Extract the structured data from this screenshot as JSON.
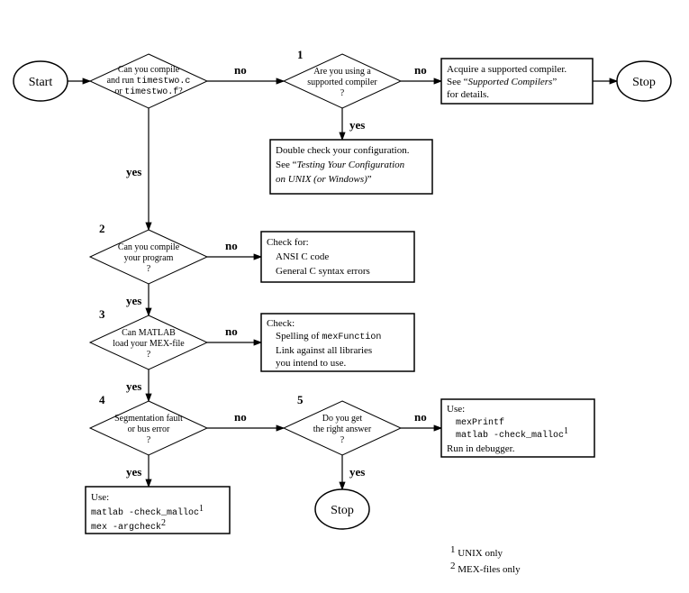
{
  "start": "Start",
  "stop": "Stop",
  "edge": {
    "yes": "yes",
    "no": "no"
  },
  "d0": {
    "l1": "Can you compile",
    "l2a": "and run ",
    "l2b": "timestwo.c",
    "l3a": "or ",
    "l3b": "timestwo.f",
    "l3c": "?"
  },
  "d1": {
    "num": "1",
    "l1": "Are you using a",
    "l2": "supported compiler",
    "l3": "?"
  },
  "p1": {
    "l1": "Acquire a supported compiler.",
    "l2a": "See “",
    "l2b": "Supported Compilers",
    "l2c": "”",
    "l3": "for details."
  },
  "p2": {
    "l1": "Double check your configuration.",
    "l2a": "See “",
    "l2b": "Testing Your Configuration",
    "l3a": "on UNIX",
    "l3b": " (or Windows)",
    "l3c": "”"
  },
  "d2": {
    "num": "2",
    "l1": "Can you compile",
    "l2": "your program",
    "l3": "?"
  },
  "p3": {
    "l1": "Check for:",
    "l2": "ANSI C code",
    "l3": "General C syntax errors"
  },
  "d3": {
    "num": "3",
    "l1": "Can MATLAB",
    "l2": "load your MEX-file",
    "l3": "?"
  },
  "p4": {
    "l1": "Check:",
    "l2a": "Spelling of ",
    "l2b": "mexFunction",
    "l3": "Link against all libraries",
    "l4": "you intend to use."
  },
  "d4": {
    "num": "4",
    "l1": "Segmentation fault",
    "l2": "or bus error",
    "l3": "?"
  },
  "p5": {
    "l1": "Use:",
    "l2": "matlab -check_malloc",
    "l2sup": "1",
    "l3": "mex -argcheck",
    "l3sup": "2"
  },
  "d5": {
    "num": "5",
    "l1": "Do you get",
    "l2": "the right answer",
    "l3": "?"
  },
  "p6": {
    "l1": "Use:",
    "l2": "mexPrintf",
    "l3": "matlab -check_malloc",
    "l3sup": "1",
    "l4": "Run in debugger."
  },
  "foot": {
    "n1sup": "1",
    "n1": " UNIX only",
    "n2sup": "2",
    "n2": " MEX-files only"
  },
  "chart_data": {
    "type": "flowchart",
    "nodes": [
      {
        "id": "start",
        "type": "terminal",
        "text": "Start"
      },
      {
        "id": "d0",
        "type": "decision",
        "text": "Can you compile and run timestwo.c or timestwo.f?"
      },
      {
        "id": "d1",
        "type": "decision",
        "number": 1,
        "text": "Are you using a supported compiler?"
      },
      {
        "id": "p1",
        "type": "process",
        "text": "Acquire a supported compiler. See \"Supported Compilers\" for details."
      },
      {
        "id": "stop1",
        "type": "terminal",
        "text": "Stop"
      },
      {
        "id": "p2",
        "type": "process",
        "text": "Double check your configuration. See \"Testing Your Configuration on UNIX (or Windows)\""
      },
      {
        "id": "d2",
        "type": "decision",
        "number": 2,
        "text": "Can you compile your program?"
      },
      {
        "id": "p3",
        "type": "process",
        "text": "Check for: ANSI C code; General C syntax errors"
      },
      {
        "id": "d3",
        "type": "decision",
        "number": 3,
        "text": "Can MATLAB load your MEX-file?"
      },
      {
        "id": "p4",
        "type": "process",
        "text": "Check: Spelling of mexFunction; Link against all libraries you intend to use."
      },
      {
        "id": "d4",
        "type": "decision",
        "number": 4,
        "text": "Segmentation fault or bus error?"
      },
      {
        "id": "p5",
        "type": "process",
        "text": "Use: matlab -check_malloc [1]; mex -argcheck [2]"
      },
      {
        "id": "d5",
        "type": "decision",
        "number": 5,
        "text": "Do you get the right answer?"
      },
      {
        "id": "p6",
        "type": "process",
        "text": "Use: mexPrintf; matlab -check_malloc [1]; Run in debugger."
      },
      {
        "id": "stop2",
        "type": "terminal",
        "text": "Stop"
      }
    ],
    "edges": [
      {
        "from": "start",
        "to": "d0"
      },
      {
        "from": "d0",
        "to": "d1",
        "label": "no"
      },
      {
        "from": "d0",
        "to": "d2",
        "label": "yes"
      },
      {
        "from": "d1",
        "to": "p1",
        "label": "no"
      },
      {
        "from": "d1",
        "to": "p2",
        "label": "yes"
      },
      {
        "from": "p1",
        "to": "stop1"
      },
      {
        "from": "d2",
        "to": "p3",
        "label": "no"
      },
      {
        "from": "d2",
        "to": "d3",
        "label": "yes"
      },
      {
        "from": "d3",
        "to": "p4",
        "label": "no"
      },
      {
        "from": "d3",
        "to": "d4",
        "label": "yes"
      },
      {
        "from": "d4",
        "to": "d5",
        "label": "no"
      },
      {
        "from": "d4",
        "to": "p5",
        "label": "yes"
      },
      {
        "from": "d5",
        "to": "p6",
        "label": "no"
      },
      {
        "from": "d5",
        "to": "stop2",
        "label": "yes"
      }
    ],
    "footnotes": [
      {
        "mark": "1",
        "text": "UNIX only"
      },
      {
        "mark": "2",
        "text": "MEX-files only"
      }
    ]
  }
}
